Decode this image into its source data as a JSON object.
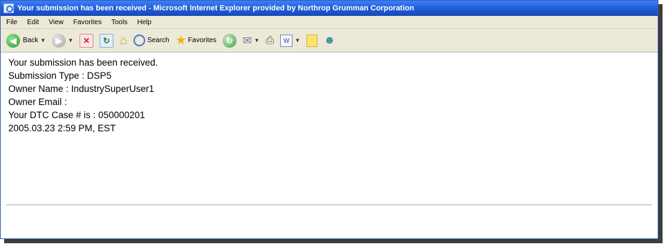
{
  "window": {
    "title": "Your submission has been received - Microsoft Internet Explorer provided by Northrop Grumman Corporation"
  },
  "menu": [
    "File",
    "Edit",
    "View",
    "Favorites",
    "Tools",
    "Help"
  ],
  "toolbar": {
    "back_label": "Back",
    "search_label": "Search",
    "favorites_label": "Favorites"
  },
  "content": {
    "lines": [
      "Your submission has been received.",
      "Submission Type : DSP5",
      "Owner Name : IndustrySuperUser1",
      "Owner Email :",
      "Your DTC Case # is : 050000201",
      "2005.03.23 2:59 PM, EST"
    ]
  }
}
